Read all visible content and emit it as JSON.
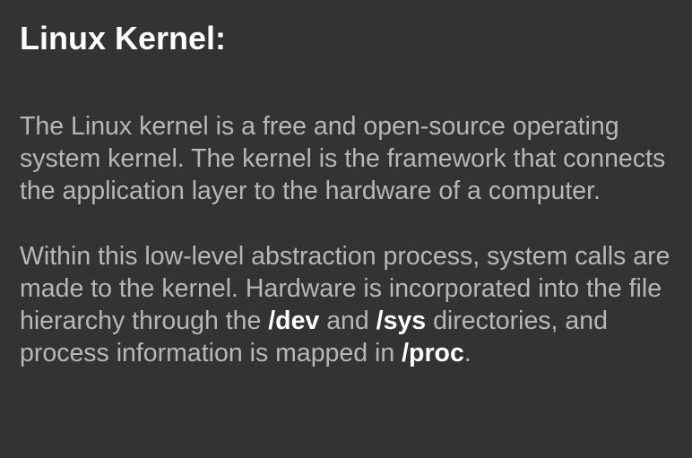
{
  "slide": {
    "title": "Linux Kernel:",
    "paragraph1": "The Linux kernel is a free and open-source operating system kernel.  The kernel is the framework that connects the application layer to the hardware of a computer.",
    "paragraph2": {
      "part1": "Within this low-level abstraction process, system calls are made to the kernel.  Hardware is incorporated into the file hierarchy through the ",
      "path_dev": "/dev",
      "part2": " and ",
      "path_sys": "/sys",
      "part3": " directories, and process information is mapped in ",
      "path_proc": "/proc",
      "part4": "."
    }
  },
  "colors": {
    "background": "#333333",
    "title": "#ffffff",
    "body_text": "#b7b7b7",
    "highlight": "#ffffff"
  }
}
